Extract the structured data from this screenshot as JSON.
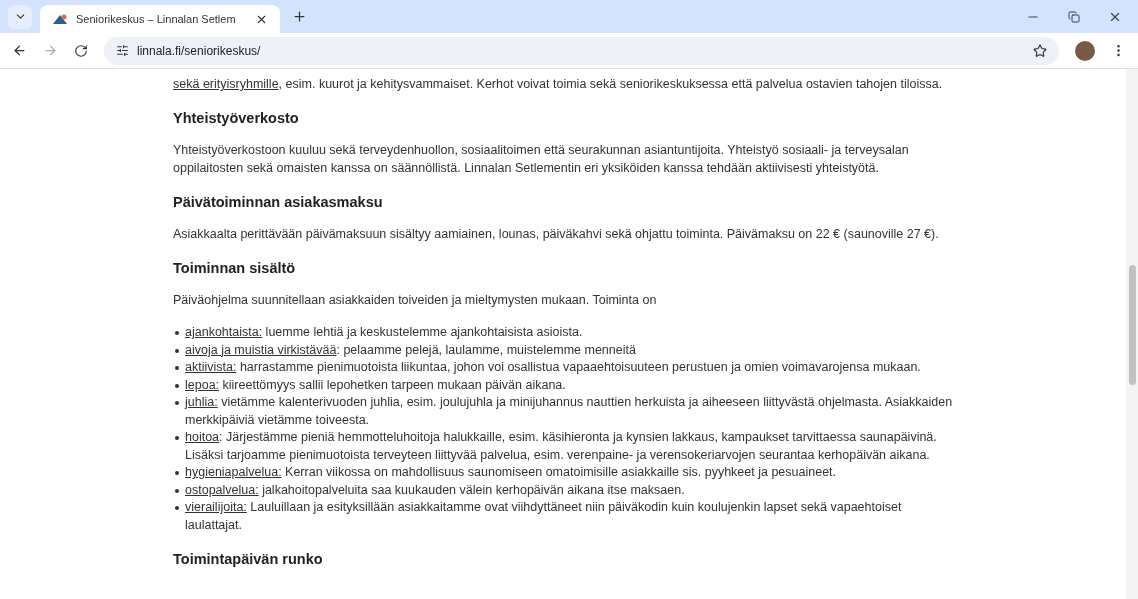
{
  "browser": {
    "tab_title": "Seniorikeskus – Linnalan Setlem",
    "url": "linnala.fi/seniorikeskus/"
  },
  "intro": {
    "link": "sekä erityisryhmille",
    "text": ", esim. kuurot ja kehitysvammaiset. Kerhot voivat toimia sekä seniorikeskuksessa että palvelua ostavien tahojen tiloissa."
  },
  "sections": [
    {
      "heading": "Yhteistyöverkosto",
      "paragraph": "Yhteistyöverkostoon kuuluu sekä terveydenhuollon, sosiaalitoimen että seurakunnan asiantuntijoita. Yhteistyö sosiaali- ja terveysalan oppilaitosten sekä omaisten kanssa on säännöllistä. Linnalan Setlementin eri yksiköiden kanssa tehdään aktiivisesti yhteistyötä."
    },
    {
      "heading": "Päivätoiminnan asiakasmaksu",
      "paragraph": "Asiakkaalta perittävään päivämaksuun sisältyy aamiainen, lounas, päiväkahvi sekä ohjattu toiminta. Päivämaksu on 22 € (saunoville 27 €)."
    },
    {
      "heading": "Toiminnan sisältö",
      "paragraph": "Päiväohjelma suunnitellaan asiakkaiden toiveiden ja mieltymysten mukaan. Toiminta on",
      "items": [
        {
          "term": "ajankohtaista:",
          "text": " luemme lehtiä ja keskustelemme ajankohtaisista asioista."
        },
        {
          "term": "aivoja ja muistia virkistävää",
          "text": ": pelaamme pelejä, laulamme, muistelemme menneitä"
        },
        {
          "term": "aktiivista:",
          "text": " harrastamme pienimuotoista liikuntaa, johon voi osallistua vapaaehtoisuuteen perustuen ja omien voimavarojensa mukaan."
        },
        {
          "term": "lepoa:",
          "text": " kiireettömyys sallii lepohetken tarpeen mukaan päivän aikana."
        },
        {
          "term": "juhlia:",
          "text": " vietämme kalenterivuoden juhlia, esim. joulujuhla ja minijuhannus nauttien herkuista ja aiheeseen liittyvästä ohjelmasta. Asiakkaiden merkkipäiviä vietämme toiveesta."
        },
        {
          "term": "hoitoa",
          "text": ": Järjestämme pieniä hemmotteluhoitoja halukkaille, esim. käsihieronta ja kynsien lakkaus, kampaukset tarvittaessa saunapäivinä. Lisäksi tarjoamme pienimuotoista terveyteen liittyvää palvelua, esim. verenpaine- ja verensokeriarvojen seurantaa kerhopäivän aikana."
        },
        {
          "term": "hygieniapalvelua:",
          "text": " Kerran viikossa on mahdollisuus saunomiseen omatoimisille asiakkaille sis. pyyhkeet ja pesuaineet."
        },
        {
          "term": "ostopalvelua:",
          "text": " jalkahoitopalveluita saa kuukauden välein kerhopäivän aikana itse maksaen."
        },
        {
          "term": "vierailijoita:",
          "text": " Lauluillaan ja esityksillään asiakkaitamme ovat viihdyttäneet niin päiväkodin kuin koulujenkin lapset sekä vapaehtoiset laulattajat."
        }
      ]
    },
    {
      "heading": "Toimintapäivän runko"
    }
  ]
}
